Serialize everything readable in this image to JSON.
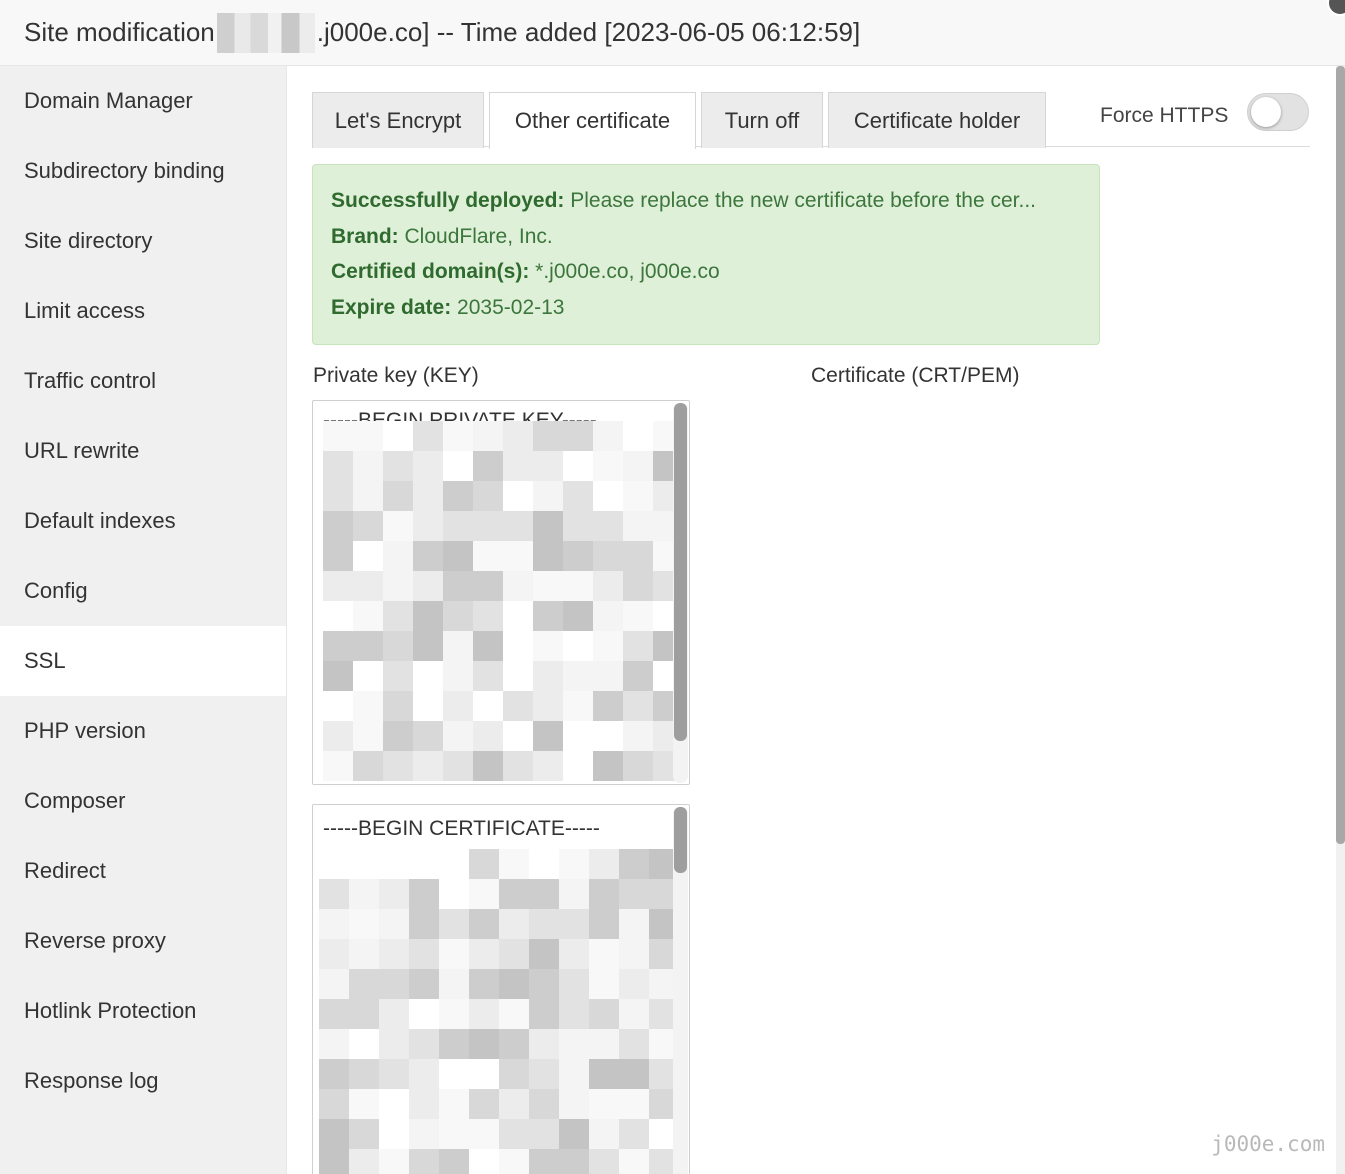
{
  "window": {
    "title_prefix": "Site modification",
    "title_suffix": ".j000e.co] -- Time added [2023-06-05 06:12:59]"
  },
  "sidebar": {
    "items": [
      {
        "label": "Domain Manager"
      },
      {
        "label": "Subdirectory binding"
      },
      {
        "label": "Site directory"
      },
      {
        "label": "Limit access"
      },
      {
        "label": "Traffic control"
      },
      {
        "label": "URL rewrite"
      },
      {
        "label": "Default indexes"
      },
      {
        "label": "Config"
      },
      {
        "label": "SSL",
        "active": true
      },
      {
        "label": "PHP version"
      },
      {
        "label": "Composer"
      },
      {
        "label": "Redirect"
      },
      {
        "label": "Reverse proxy"
      },
      {
        "label": "Hotlink Protection"
      },
      {
        "label": "Response log"
      }
    ]
  },
  "tabs": [
    {
      "label": "Let's Encrypt",
      "active": false
    },
    {
      "label": "Other certificate",
      "active": true
    },
    {
      "label": "Turn off",
      "active": false
    },
    {
      "label": "Certificate holder",
      "active": false
    }
  ],
  "force_https": {
    "label": "Force HTTPS",
    "enabled": false
  },
  "alert": {
    "status_label": "Successfully deployed:",
    "status_text": " Please replace the new certificate before the cer...",
    "brand_label": "Brand:",
    "brand_value": " CloudFlare, Inc.",
    "domains_label": "Certified domain(s):",
    "domains_value": " *.j000e.co, j000e.co",
    "expire_label": "Expire date:",
    "expire_value": " 2035-02-13"
  },
  "fields": {
    "key_label": "Private key (KEY)",
    "crt_label": "Certificate (CRT/PEM)",
    "key_head": "-----BEGIN PRIVATE KEY-----",
    "crt_head": "-----BEGIN CERTIFICATE-----"
  },
  "colors": {
    "alert_bg": "#dff0d8",
    "alert_text": "#3c763d",
    "sidebar_bg": "#f0f0f0",
    "active_bg": "#ffffff"
  },
  "watermark": "j000e.com"
}
